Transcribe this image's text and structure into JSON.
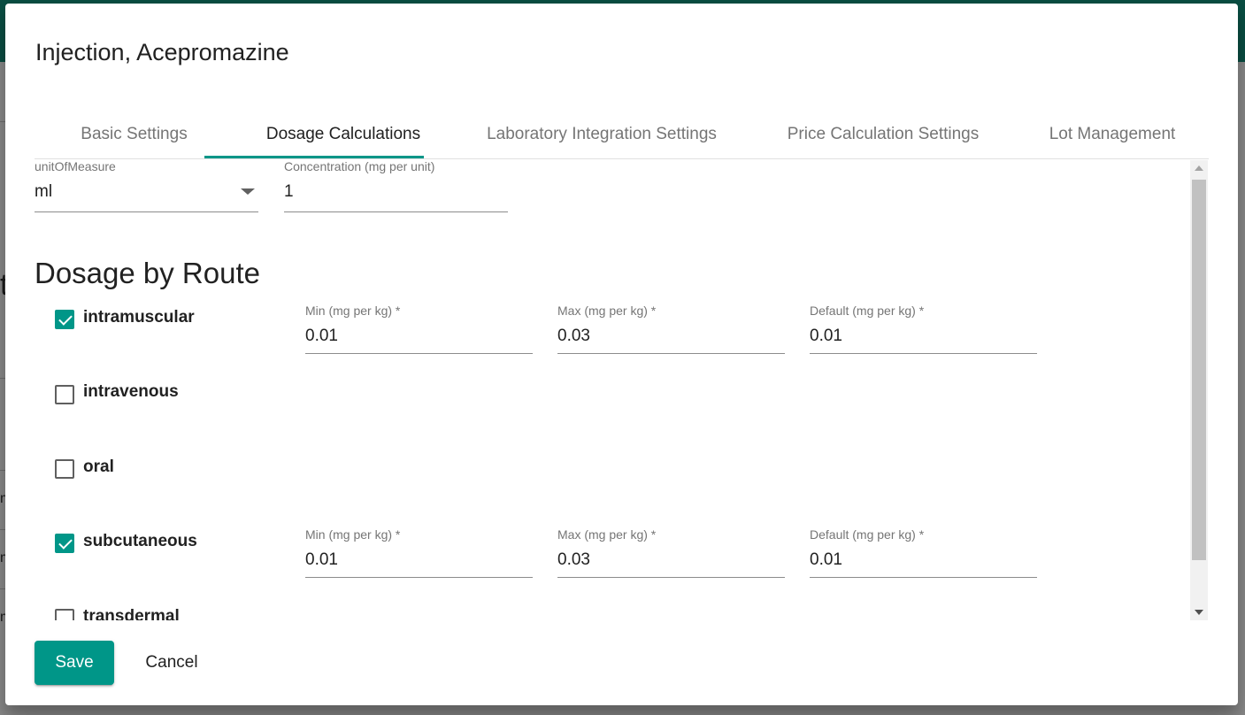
{
  "dialog": {
    "title": "Injection, Acepromazine",
    "accent_color": "#009688"
  },
  "tabs": [
    {
      "label": "Basic Settings",
      "active": false
    },
    {
      "label": "Dosage Calculations",
      "active": true
    },
    {
      "label": "Laboratory Integration Settings",
      "active": false
    },
    {
      "label": "Price Calculation Settings",
      "active": false
    },
    {
      "label": "Lot Management",
      "active": false
    }
  ],
  "unit": {
    "label": "unitOfMeasure",
    "value": "ml"
  },
  "concentration": {
    "label": "Concentration (mg per unit)",
    "value": "1"
  },
  "section_title": "Dosage by Route",
  "routes": [
    {
      "name": "intramuscular",
      "checked": true,
      "min_label": "Min (mg per kg) *",
      "min": "0.01",
      "max_label": "Max (mg per kg) *",
      "max": "0.03",
      "default_label": "Default (mg per kg) *",
      "default": "0.01"
    },
    {
      "name": "intravenous",
      "checked": false
    },
    {
      "name": "oral",
      "checked": false
    },
    {
      "name": "subcutaneous",
      "checked": true,
      "min_label": "Min (mg per kg) *",
      "min": "0.01",
      "max_label": "Max (mg per kg) *",
      "max": "0.03",
      "default_label": "Default (mg per kg) *",
      "default": "0.01"
    },
    {
      "name": "transdermal",
      "checked": false
    }
  ],
  "actions": {
    "save_label": "Save",
    "cancel_label": "Cancel"
  },
  "background": {
    "fragment_t": "t",
    "fragment_m": "m"
  }
}
